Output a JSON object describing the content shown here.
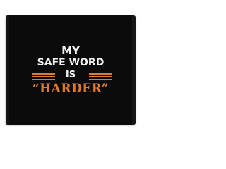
{
  "design": {
    "line1": "MY",
    "line2": "SAFE WORD",
    "line3": "IS",
    "line4": "“HARDER”"
  },
  "colors": {
    "background": "#ffffff",
    "towel": "#0b0b0b",
    "text_primary": "#f2f2f2",
    "accent": "#e07a2c"
  }
}
